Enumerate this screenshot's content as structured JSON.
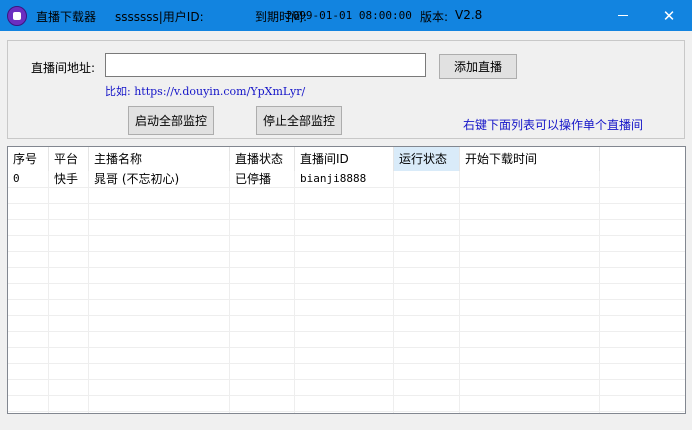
{
  "window": {
    "title": "直播下载器",
    "user_line": "sssssss|用户ID:",
    "expire_label": "到期时间:",
    "expire_value": "2099-01-01 08:00:00",
    "version_label": "版本:",
    "version_value": "V2.8",
    "close_glyph": "✕",
    "colors": {
      "titlebar": "#1284e0",
      "link": "#1515c8"
    }
  },
  "form": {
    "url_label": "直播间地址:",
    "url_value": "",
    "add_button": "添加直播",
    "example_text": "比如: https://v.douyin.com/YpXmLyr/",
    "start_all_button": "启动全部监控",
    "stop_all_button": "停止全部监控",
    "hint_text": "右键下面列表可以操作单个直播间"
  },
  "table": {
    "columns": [
      "序号",
      "平台",
      "主播名称",
      "直播状态",
      "直播间ID",
      "运行状态",
      "开始下载时间"
    ],
    "rows": [
      [
        "0",
        "快手",
        "晁哥 (不忘初心)",
        "已停播",
        "bianji8888",
        "",
        ""
      ]
    ]
  }
}
